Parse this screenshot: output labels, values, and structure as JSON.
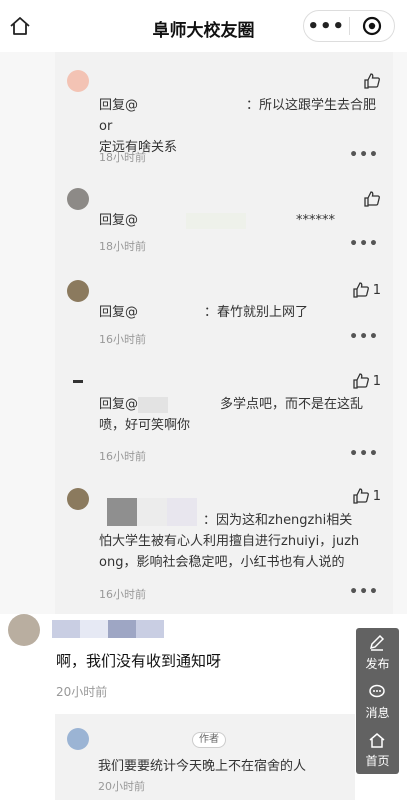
{
  "header": {
    "title": "阜师大校友圈",
    "more_label": "•••"
  },
  "replies": [
    {
      "reply_prefix": "回复@",
      "text_line1": "：所以这跟学生去合肥or",
      "text_line2": "定远有啥关系",
      "time": "18小时前",
      "likes": ""
    },
    {
      "reply_prefix": "回复@",
      "text_line1": "******",
      "text_line2": "",
      "time": "18小时前",
      "likes": ""
    },
    {
      "reply_prefix": "回复@",
      "text_line1": "：春竹就别上网了",
      "text_line2": "",
      "time": "16小时前",
      "likes": "1"
    },
    {
      "reply_prefix": "回复@",
      "text_line1": "多学点吧，而不是在这乱",
      "text_line2": "喷，好可笑啊你",
      "time": "16小时前",
      "likes": "1"
    },
    {
      "reply_prefix": "",
      "text_line1": "：因为这和zhengzhi相关",
      "text_line2": "怕大学生被有心人利用擅自进行zhuiyi，juzh",
      "text_line3": "ong，影响社会稳定吧，小红书也有人说的",
      "time": "16小时前",
      "likes": "1"
    }
  ],
  "main_comment": {
    "text": "啊，我们没有收到通知呀",
    "time": "20小时前"
  },
  "sub_reply": {
    "badge": "作者",
    "text": "我们要要统计今天晚上不在宿舍的人",
    "time": "20小时前"
  },
  "float_bar": {
    "post": "发布",
    "message": "消息",
    "home": "首页"
  },
  "reply_more": "•••"
}
